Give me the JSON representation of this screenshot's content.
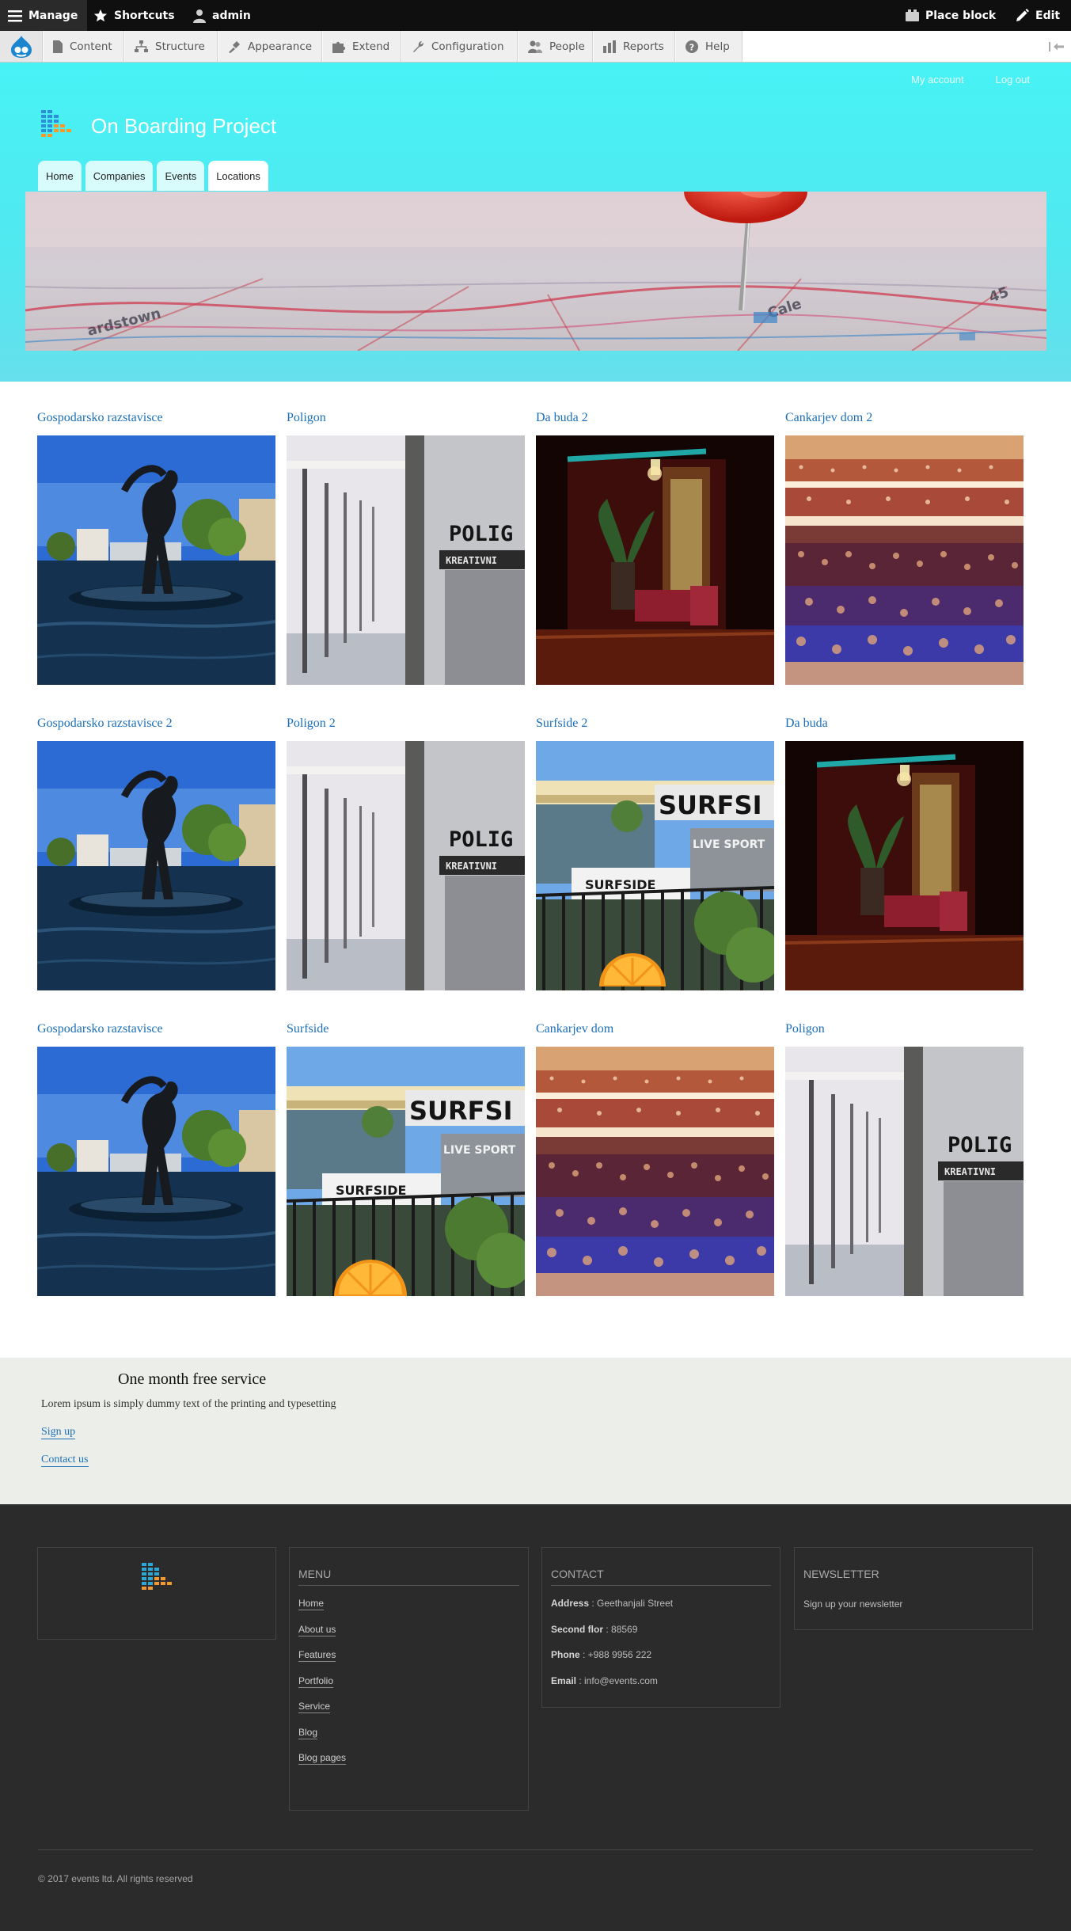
{
  "toolbar": {
    "manage": "Manage",
    "shortcuts": "Shortcuts",
    "user": "admin",
    "place_block": "Place block",
    "edit": "Edit"
  },
  "admin_menu": {
    "items": [
      "Content",
      "Structure",
      "Appearance",
      "Extend",
      "Configuration",
      "People",
      "Reports",
      "Help"
    ]
  },
  "header": {
    "user_links": [
      "My account",
      "Log out"
    ],
    "site_name": "On Boarding Project",
    "nav": [
      "Home",
      "Companies",
      "Events",
      "Locations"
    ],
    "active_nav": "Locations"
  },
  "locations": [
    {
      "title": "Gospodarsko razstavisce",
      "image": "statue-fountain"
    },
    {
      "title": "Poligon",
      "image": "poligon-glass"
    },
    {
      "title": "Da buda 2",
      "image": "lounge-interior"
    },
    {
      "title": "Cankarjev dom 2",
      "image": "concert-hall"
    },
    {
      "title": "Gospodarsko razstavisce 2",
      "image": "statue-fountain"
    },
    {
      "title": "Poligon 2",
      "image": "poligon-glass"
    },
    {
      "title": "Surfside 2",
      "image": "surfside-terrace"
    },
    {
      "title": "Da buda",
      "image": "lounge-interior"
    },
    {
      "title": "Gospodarsko razstavisce",
      "image": "statue-fountain"
    },
    {
      "title": "Surfside",
      "image": "surfside-terrace"
    },
    {
      "title": "Cankarjev dom",
      "image": "concert-hall"
    },
    {
      "title": "Poligon",
      "image": "poligon-glass"
    }
  ],
  "image_text": {
    "poligon": "POLIG",
    "poligon_sub": "KREATIVNI",
    "surfside": "SURFSI",
    "surfside_live": "LIVE SPORT",
    "surfside_small": "SURFSIDE"
  },
  "promo": {
    "heading": "One month free service",
    "text": "Lorem ipsum is simply dummy text of the printing and typesetting",
    "signup": "Sign up",
    "contact": "Contact us"
  },
  "footer": {
    "menu_title": "MENU",
    "menu_items": [
      "Home",
      "About us",
      "Features",
      "Portfolio",
      "Service",
      "Blog",
      "Blog pages"
    ],
    "contact_title": "CONTACT",
    "contact": [
      {
        "label": "Address",
        "value": " : Geethanjali Street"
      },
      {
        "label": "Second flor",
        "value": " : 88569"
      },
      {
        "label": "Phone",
        "value": " : +988 9956 222"
      },
      {
        "label": "Email",
        "value": " : info@events.com"
      }
    ],
    "newsletter_title": "NEWSLETTER",
    "newsletter_text": "Sign up your newsletter",
    "copyright": "© 2017 events ltd. All rights reserved"
  },
  "colors": {
    "header_cyan": "#47f2f5",
    "link_blue": "#1b6fb8",
    "footer_bg": "#2b2b2b",
    "promo_bg": "#eceee9"
  }
}
